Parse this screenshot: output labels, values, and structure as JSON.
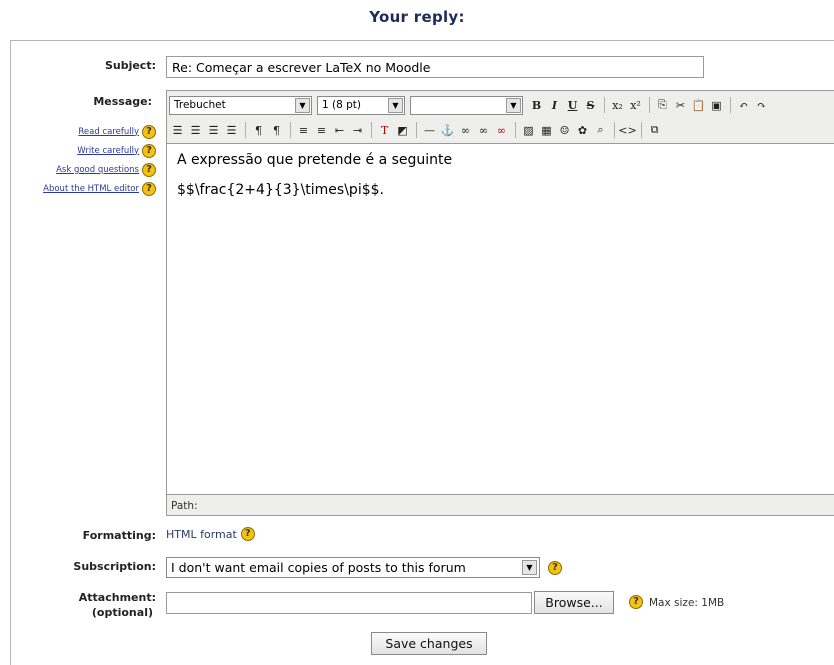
{
  "heading": "Your reply:",
  "labels": {
    "subject": "Subject:",
    "message": "Message:",
    "formatting": "Formatting:",
    "subscription": "Subscription:",
    "attachment": "Attachment:",
    "attachment_optional": "(optional)"
  },
  "subject_value": "Re: Começar a escrever LaTeX no Moodle",
  "help_links": [
    "Read carefully",
    "Write carefully",
    "Ask good questions",
    "About the HTML editor"
  ],
  "editor": {
    "font": "Trebuchet",
    "size": "1 (8 pt)",
    "style": "",
    "content_lines": [
      "A expressão que pretende é a seguinte",
      "$$\\frac{2+4}{3}\\times\\pi$$."
    ],
    "path_label": "Path:"
  },
  "formatting_value": "HTML format",
  "subscription_value": "I don't want email copies of posts to this forum",
  "browse_label": "Browse...",
  "max_size": "Max size: 1MB",
  "save_label": "Save changes",
  "colors": {
    "heading": "#1e2a5c",
    "link": "#2a3a9a",
    "help_icon": "#f5c211"
  }
}
